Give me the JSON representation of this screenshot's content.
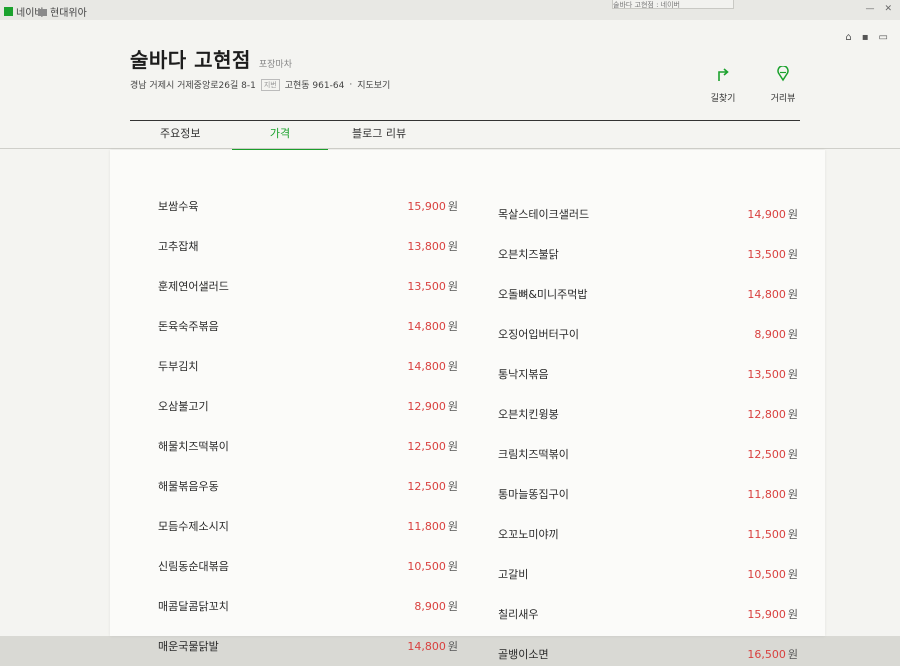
{
  "browser": {
    "bookmarks": [
      "네이버",
      "현대위아"
    ],
    "tab_title": "술바다 고현점 : 네이버"
  },
  "place": {
    "name": "술바다 고현점",
    "category": "포장마차",
    "address": "경남 거제시 거제중앙로26길 8-1",
    "jibun_tag": "지번",
    "jibun": "고현동 961-64",
    "map_link": "지도보기"
  },
  "actions": [
    {
      "label": "길찾기",
      "icon": "directions-icon"
    },
    {
      "label": "거리뷰",
      "icon": "street-view-icon"
    }
  ],
  "tabs": [
    {
      "label": "주요정보",
      "active": false
    },
    {
      "label": "가격",
      "active": true
    },
    {
      "label": "블로그 리뷰",
      "active": false
    }
  ],
  "price_unit": "원",
  "menu_left": [
    {
      "name": "보쌈수육",
      "price": "15,900"
    },
    {
      "name": "고추잡채",
      "price": "13,800"
    },
    {
      "name": "훈제연어샐러드",
      "price": "13,500"
    },
    {
      "name": "돈육숙주볶음",
      "price": "14,800"
    },
    {
      "name": "두부김치",
      "price": "14,800"
    },
    {
      "name": "오삼불고기",
      "price": "12,900"
    },
    {
      "name": "해물치즈떡볶이",
      "price": "12,500"
    },
    {
      "name": "해물볶음우동",
      "price": "12,500"
    },
    {
      "name": "모듬수제소시지",
      "price": "11,800"
    },
    {
      "name": "신림동순대볶음",
      "price": "10,500"
    },
    {
      "name": "매콤달콤닭꼬치",
      "price": "8,900"
    },
    {
      "name": "매운국물닭발",
      "price": "14,800"
    }
  ],
  "menu_right": [
    {
      "name": "목살스테이크샐러드",
      "price": "14,900"
    },
    {
      "name": "오븐치즈불닭",
      "price": "13,500"
    },
    {
      "name": "오돌뼈&미니주먹밥",
      "price": "14,800"
    },
    {
      "name": "오징어입버터구이",
      "price": "8,900"
    },
    {
      "name": "통낙지볶음",
      "price": "13,500"
    },
    {
      "name": "오븐치킨윙봉",
      "price": "12,800"
    },
    {
      "name": "크림치즈떡볶이",
      "price": "12,500"
    },
    {
      "name": "통마늘똥집구이",
      "price": "11,800"
    },
    {
      "name": "오꼬노미야끼",
      "price": "11,500"
    },
    {
      "name": "고갈비",
      "price": "10,500"
    },
    {
      "name": "칠리새우",
      "price": "15,900"
    },
    {
      "name": "골뱅이소면",
      "price": "16,500"
    }
  ],
  "colors": {
    "accent": "#1ba22d",
    "price": "#d9413f"
  }
}
